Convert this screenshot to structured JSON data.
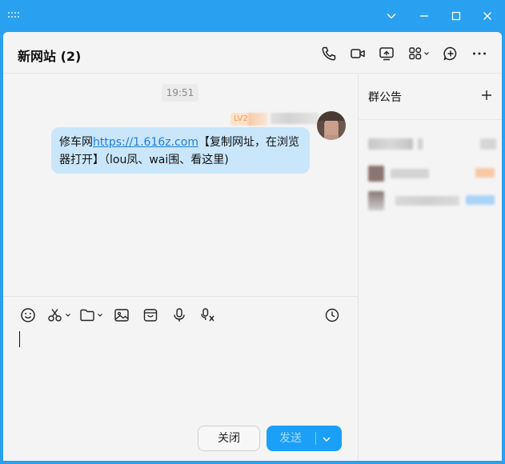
{
  "window": {
    "grip_icon": "drag-grid-icon",
    "controls": [
      "minimize-chevron-icon",
      "minimize-icon",
      "maximize-icon",
      "close-icon"
    ]
  },
  "header": {
    "title": "新网站 (2)",
    "actions": [
      "phone-icon",
      "video-icon",
      "screen-share-icon",
      "apps-icon",
      "add-chat-icon",
      "more-icon"
    ]
  },
  "chat": {
    "timestamp": "19:51",
    "message": {
      "sender_level": "LV2",
      "text_before": "修车网",
      "link": "https://1.616z.com",
      "text_after": "【复制网址，在浏览器打开】（lou凤、wai围、看这里)"
    }
  },
  "toolbar": {
    "tools": [
      "emoji-icon",
      "scissors-icon",
      "folder-icon",
      "image-icon",
      "box-icon",
      "microphone-icon",
      "voice-to-text-icon",
      "history-clock-icon"
    ]
  },
  "composer": {
    "close_label": "关闭",
    "send_label": "发送"
  },
  "side": {
    "title": "群公告",
    "add_icon": "plus-icon"
  },
  "colors": {
    "accent": "#2aa0f0",
    "bubble": "#c9e6fb",
    "link": "#1e7fd8",
    "send": "#1aa0f6"
  }
}
